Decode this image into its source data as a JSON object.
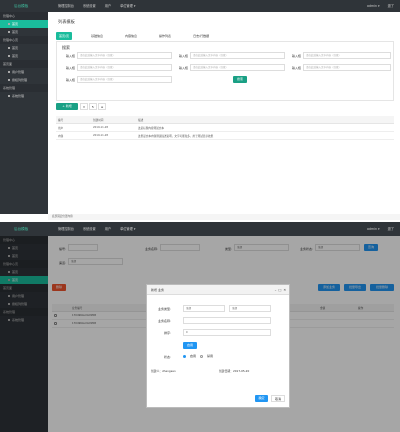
{
  "app": {
    "brand": "后台模板",
    "nav": [
      "管理控制台",
      "系统设置",
      "用户",
      "单位管理 ▾"
    ],
    "user": "admin ▾",
    "logout": "退了"
  },
  "sidebar": {
    "groups": [
      {
        "title": "管理中心",
        "items": [
          {
            "label": "首页",
            "active": true
          },
          {
            "label": "首页",
            "active": false
          }
        ]
      },
      {
        "title": "管理中心页",
        "items": [
          {
            "label": "首页",
            "active": false
          },
          {
            "label": "首页",
            "active": false
          }
        ]
      },
      {
        "title": "首页面",
        "items": [
          {
            "label": "用户管理",
            "active": false
          },
          {
            "label": "授权列管理",
            "active": false
          }
        ]
      },
      {
        "title": "系统管理",
        "items": [
          {
            "label": "系统管理",
            "active": false
          }
        ]
      }
    ]
  },
  "top": {
    "page_title": "列表模板",
    "tabs": [
      "首页/页",
      "基础信息",
      "内容信息",
      "操作列表",
      "日志/行数据"
    ],
    "search": {
      "title": "搜索",
      "fields": [
        {
          "label": "输入框",
          "placeholder": "请在此处输入文字内容（任意）"
        },
        {
          "label": "输入框",
          "placeholder": "请在此处输入文字内容（任意）"
        },
        {
          "label": "输入框",
          "placeholder": "请在此处输入文字内容（任意）"
        },
        {
          "label": "输入框",
          "placeholder": "请在此处输入文字内容（任意）"
        },
        {
          "label": "输入框",
          "placeholder": "请在此处输入文字内容（任意）"
        },
        {
          "label": "输入框",
          "placeholder": "请在此处输入文字内容（任意）"
        },
        {
          "label": "输入框",
          "placeholder": "请在此处输入文字内容（任意）"
        }
      ],
      "button": "搜索"
    },
    "add_button": "+ 新增",
    "table": {
      "headers": [
        "编号",
        "创建时间",
        "描述"
      ],
      "rows": [
        [
          "用户",
          "2019-11-28",
          "这是标题内容测试文本"
        ],
        [
          "内容",
          "2019-11-28",
          "这里是文本内容测试描述说明，文字可能较多，用于测试显示效果"
        ]
      ]
    },
    "footer": "底部固定位置内容"
  },
  "bottom": {
    "filters": [
      {
        "label": "编号:",
        "value": ""
      },
      {
        "label": "业务名称:",
        "value": ""
      },
      {
        "label": "类型:",
        "value": "全部"
      },
      {
        "label": "业务状态:",
        "value": "全部"
      }
    ],
    "query": "查询",
    "filter2": {
      "label": "渠道:",
      "value": "全部"
    },
    "delete_btn": "删除",
    "actions": [
      "添加业务",
      "批量导出",
      "批量删除"
    ],
    "table": {
      "headers": [
        "",
        "业务编号",
        "",
        "状态",
        "金额",
        "操作"
      ],
      "rows": [
        [
          "",
          "170496ALXAC9M8",
          "",
          "",
          "",
          ""
        ],
        [
          "",
          "170496ALXAC9M8",
          "",
          "",
          "",
          ""
        ]
      ]
    },
    "modal": {
      "title": "新增 业务",
      "fields": [
        {
          "label": "业务类型:",
          "value": "全部",
          "value2": "全部"
        },
        {
          "label": "业务名称:",
          "value": ""
        },
        {
          "label": "排序:",
          "value": "0"
        }
      ],
      "status_btn": "启用",
      "radio_label": "状态:",
      "radio": [
        "启用",
        "禁用"
      ],
      "creator": "创建人：zhangsan",
      "created": "创建日期：2017-05-20",
      "confirm": "确定",
      "cancel": "取消"
    }
  },
  "colors": {
    "teal": "#1abc9c",
    "dark": "#2f3439",
    "blue": "#2196f3",
    "orange": "#f0542d"
  }
}
